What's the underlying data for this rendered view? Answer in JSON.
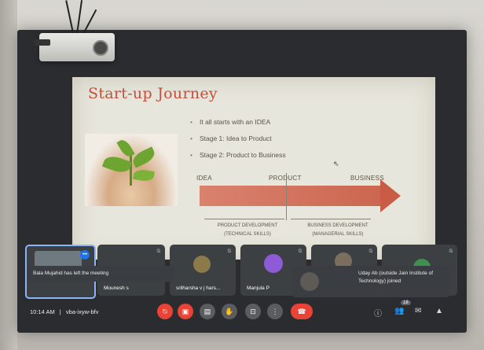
{
  "slide": {
    "title": "Start-up Journey",
    "bullets": [
      "It all starts with an IDEA",
      "Stage 1: Idea to Product",
      "Stage 2: Product to Business"
    ],
    "stage_labels": [
      "IDEA",
      "PRODUCT",
      "BUSINESS"
    ],
    "bracket_left": [
      "PRODUCT DEVELOPMENT",
      "(TECHNICAL SKILLS)"
    ],
    "bracket_right": [
      "BUSINESS DEVELOPMENT",
      "(MANAGERIAL SKILLS)"
    ]
  },
  "participants": [
    {
      "name": "",
      "badge": "•••"
    },
    {
      "name": "Mounesh s"
    },
    {
      "name": "srilharsha v j hars..."
    },
    {
      "name": "Manjula P"
    },
    {
      "name": ""
    },
    {
      "name": ""
    }
  ],
  "toast_left": "Bala Mujahid has left the meeting",
  "toast_right": "Uday Ab (outside Jain Institute of Technology) joined",
  "bar": {
    "time": "10:14 AM",
    "separator": "|",
    "meeting_code": "vba-ixyw-bfv",
    "people_count": "18"
  },
  "colors": {
    "accent_red": "#ea4335",
    "tile": "#3c4043",
    "arrow": "#d9826e",
    "title": "#c0503e"
  }
}
